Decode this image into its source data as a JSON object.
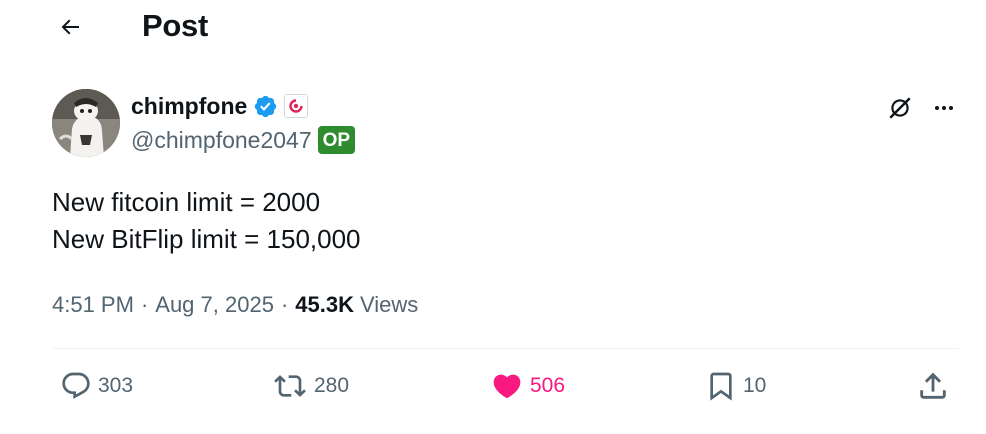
{
  "header": {
    "title": "Post",
    "back_icon": "arrow-left-icon"
  },
  "author": {
    "display_name": "chimpfone",
    "handle": "@chimpfone2047",
    "op_label": "OP",
    "verified_color": "#1d9bf0",
    "affiliate_badge_color": "#e0245e"
  },
  "post": {
    "lines": [
      "New fitcoin limit = 2000",
      "New BitFlip limit = 150,000"
    ]
  },
  "meta": {
    "time": "4:51 PM",
    "separator": "·",
    "date": "Aug 7, 2025",
    "views_count": "45.3K",
    "views_label": "Views"
  },
  "actions": {
    "reply": {
      "icon": "reply-icon",
      "count": "303"
    },
    "repost": {
      "icon": "repost-icon",
      "count": "280"
    },
    "like": {
      "icon": "heart-filled-icon",
      "count": "506",
      "color": "#f91880"
    },
    "bookmark": {
      "icon": "bookmark-icon",
      "count": "10"
    },
    "share": {
      "icon": "share-icon"
    }
  },
  "colors": {
    "text_primary": "#0f1419",
    "text_secondary": "#536471",
    "op_badge_bg": "#2e8b2e",
    "divider": "#eff3f4"
  }
}
